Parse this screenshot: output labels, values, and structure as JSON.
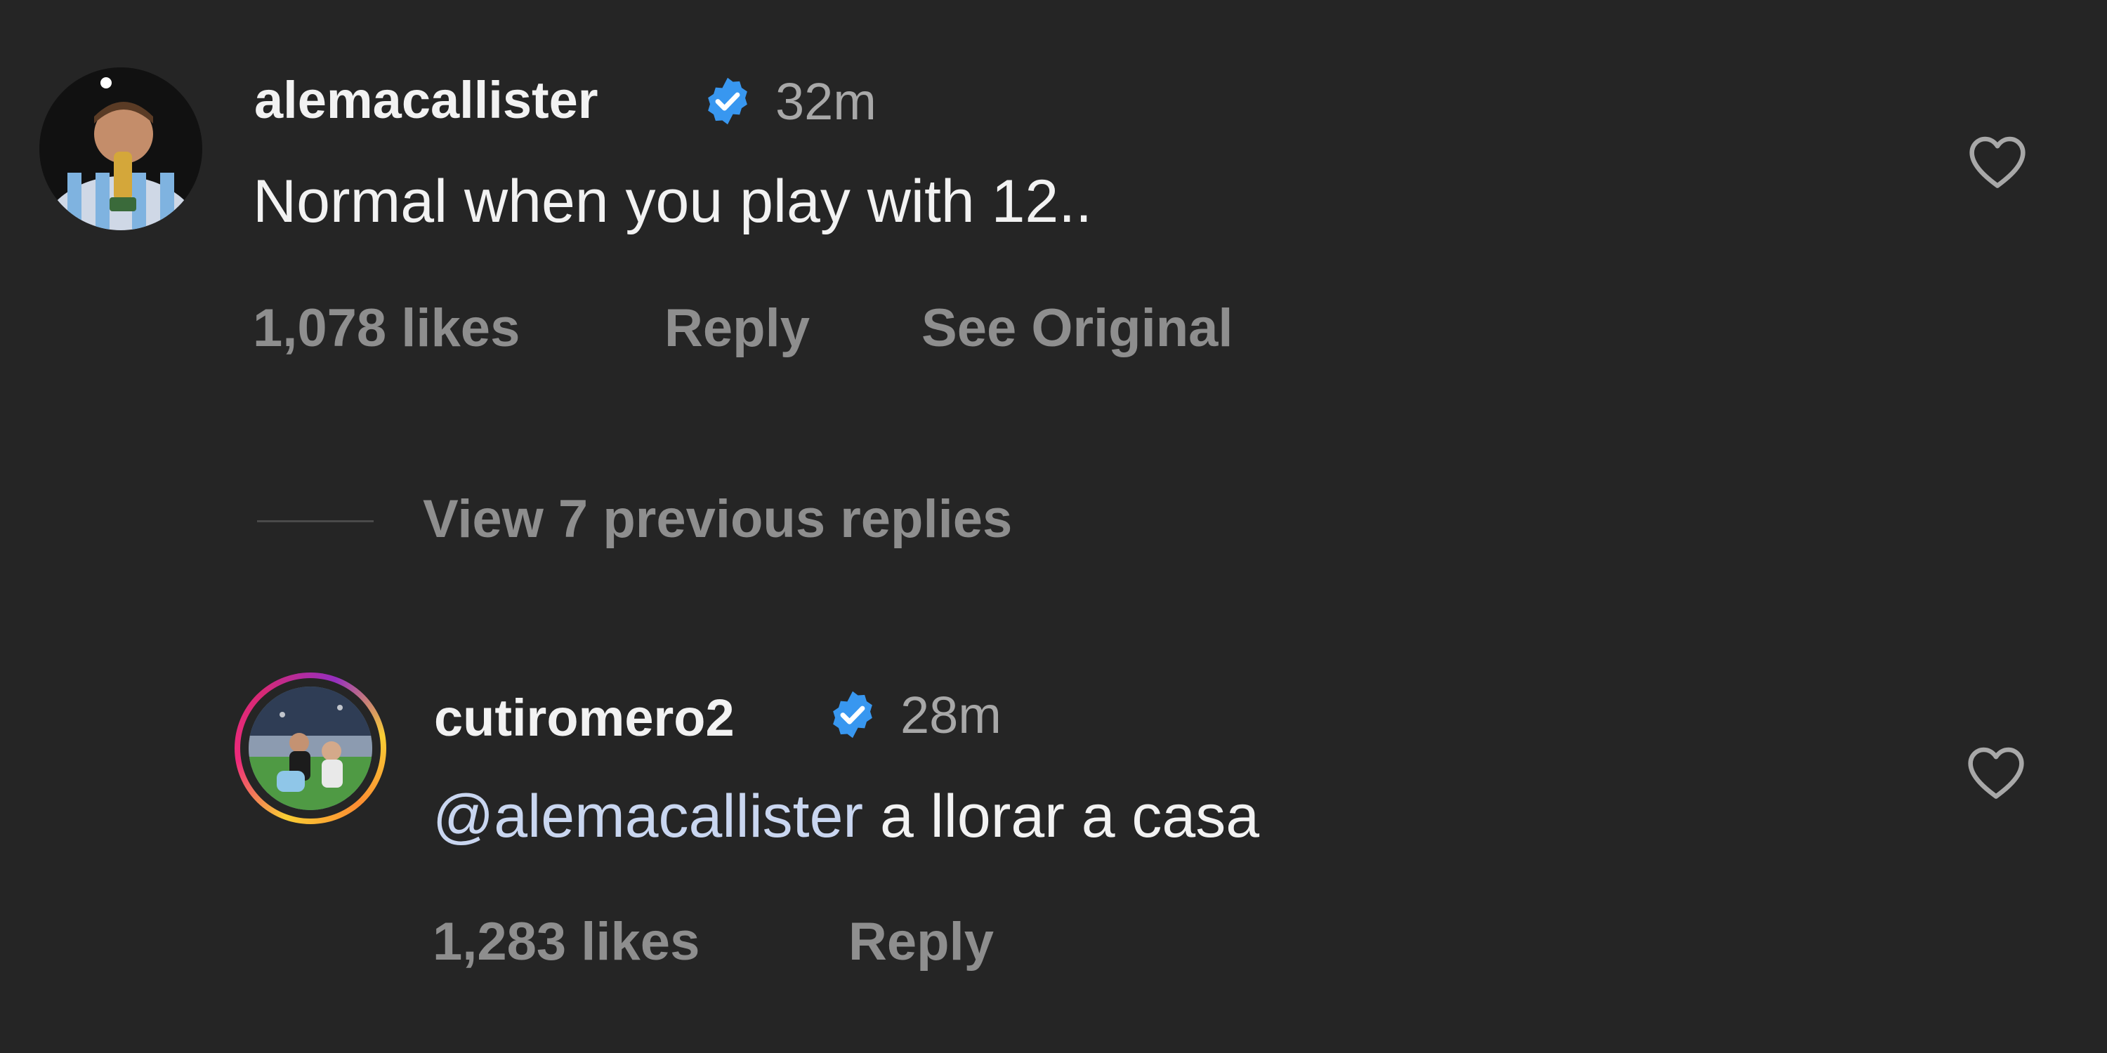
{
  "comments": [
    {
      "username": "alemacallister",
      "time": "32m",
      "text": "Normal when you play with 12..",
      "likes": "1,078 likes",
      "reply_label": "Reply",
      "see_original_label": "See Original",
      "verified": true
    }
  ],
  "replies_toggle": {
    "label": "View 7 previous replies"
  },
  "replies": [
    {
      "username": "cutiromero2",
      "time": "28m",
      "mention": "@alemacallister",
      "text": " a llorar a casa",
      "likes": "1,283 likes",
      "reply_label": "Reply",
      "verified": true
    }
  ],
  "colors": {
    "background": "#252525",
    "verified_badge": "#3897f0",
    "mention": "#c9d6f0"
  },
  "icons": {
    "verified": "verified-badge-icon",
    "like": "heart-outline-icon"
  }
}
